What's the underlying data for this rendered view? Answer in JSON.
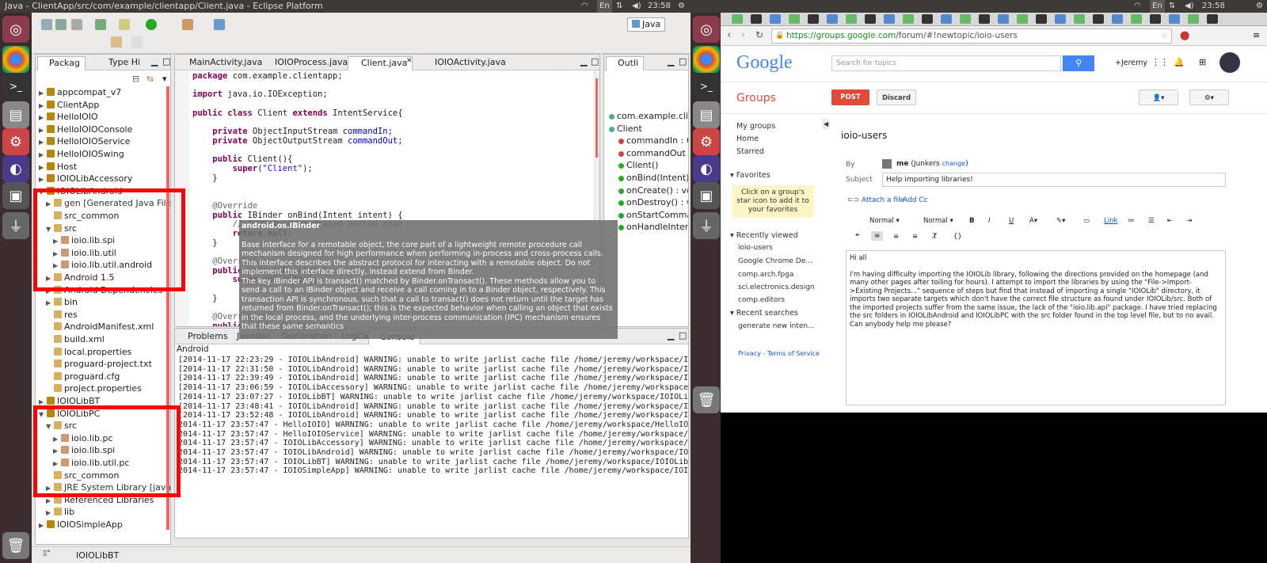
{
  "system": {
    "window_title_left": "Java - ClientApp/src/com/example/clientapp/Client.java - Eclipse Platform",
    "keyboard": "En",
    "time_left": "23:58",
    "time_right": "23:58"
  },
  "eclipse": {
    "perspective": "Java",
    "left_tabs": [
      "Packag",
      "Type Hi"
    ],
    "editor_tabs": [
      "MainActivity.java",
      "IOIOProcess.java",
      "Client.java",
      "IOIOActivity.java"
    ],
    "outline_tab": "Outli",
    "tree": [
      {
        "t": "appcompat_v7",
        "d": 0,
        "tw": "▶"
      },
      {
        "t": "ClientApp",
        "d": 0,
        "tw": "▶"
      },
      {
        "t": "HelloIOIO",
        "d": 0,
        "tw": "▶"
      },
      {
        "t": "HelloIOIOConsole",
        "d": 0,
        "tw": "▶"
      },
      {
        "t": "HelloIOIOService",
        "d": 0,
        "tw": "▶"
      },
      {
        "t": "HelloIOIOSwing",
        "d": 0,
        "tw": "▶"
      },
      {
        "t": "Host",
        "d": 0,
        "tw": "▶"
      },
      {
        "t": "IOIOLibAccessory",
        "d": 0,
        "tw": "▶"
      },
      {
        "t": "IOIOLibAndroid",
        "d": 0,
        "tw": "▼"
      },
      {
        "t": "gen [Generated Java Files]",
        "d": 1,
        "tw": "▶"
      },
      {
        "t": "src_common",
        "d": 1,
        "tw": ""
      },
      {
        "t": "src",
        "d": 1,
        "tw": "▼"
      },
      {
        "t": "ioio.lib.spi",
        "d": 2,
        "tw": "▶"
      },
      {
        "t": "ioio.lib.util",
        "d": 2,
        "tw": "▶"
      },
      {
        "t": "ioio.lib.util.android",
        "d": 2,
        "tw": "▶"
      },
      {
        "t": "Android 1.5",
        "d": 1,
        "tw": "▶"
      },
      {
        "t": "Android Dependencies",
        "d": 1,
        "tw": "▶"
      },
      {
        "t": "bin",
        "d": 1,
        "tw": "▶"
      },
      {
        "t": "res",
        "d": 1,
        "tw": ""
      },
      {
        "t": "AndroidManifest.xml",
        "d": 1,
        "tw": ""
      },
      {
        "t": "build.xml",
        "d": 1,
        "tw": ""
      },
      {
        "t": "local.properties",
        "d": 1,
        "tw": ""
      },
      {
        "t": "proguard-project.txt",
        "d": 1,
        "tw": ""
      },
      {
        "t": "proguard.cfg",
        "d": 1,
        "tw": ""
      },
      {
        "t": "project.properties",
        "d": 1,
        "tw": ""
      },
      {
        "t": "IOIOLibBT",
        "d": 0,
        "tw": "▶"
      },
      {
        "t": "IOIOLibPC",
        "d": 0,
        "tw": "▼"
      },
      {
        "t": "src",
        "d": 1,
        "tw": "▼"
      },
      {
        "t": "ioio.lib.pc",
        "d": 2,
        "tw": "▶"
      },
      {
        "t": "ioio.lib.spi",
        "d": 2,
        "tw": "▶"
      },
      {
        "t": "ioio.lib.util.pc",
        "d": 2,
        "tw": "▶"
      },
      {
        "t": "src_common",
        "d": 1,
        "tw": ""
      },
      {
        "t": "JRE System Library [java-6-orac",
        "d": 1,
        "tw": "▶"
      },
      {
        "t": "Referenced Libraries",
        "d": 1,
        "tw": "▶"
      },
      {
        "t": "lib",
        "d": 1,
        "tw": "▶"
      },
      {
        "t": "IOIOSimpleApp",
        "d": 0,
        "tw": "▶"
      }
    ],
    "outline": [
      "com.example.cli",
      "Client",
      "commandIn : O",
      "commandOut :",
      "Client()",
      "onBind(Intent)",
      "onCreate() : vo",
      "onDestroy() : v",
      "onStartComma",
      "onHandleIntent"
    ],
    "code": [
      "package com.example.clientapp;",
      "",
      "import java.io.IOException;",
      "",
      "public class Client extends IntentService{",
      "",
      "    private ObjectInputStream commandIn;",
      "    private ObjectOutputStream commandOut;",
      "",
      "    public Client(){",
      "        super(\"Client\");",
      "    }",
      "",
      "",
      "    @Override",
      "    public IBinder onBind(Intent intent) {",
      "        // TODO Auto-generated method stub",
      "        return null;",
      "    }",
      "",
      "    @Override",
      "    public void onCreate(){",
      "        super.onCreate();",
      "",
      "    }",
      "",
      "    @Override",
      "    public void onDestroy(){"
    ],
    "tooltip": {
      "title": "android.os.IBinder",
      "p1": "Base interface for a remotable object, the core part of a lightweight remote procedure call mechanism designed for high performance when performing in-process and cross-process calls. This interface describes the abstract protocol for interacting with a remotable object. Do not implement this interface directly, instead extend from Binder.",
      "p2": "The key IBinder API is transact() matched by Binder.onTransact(). These methods allow you to send a call to an IBinder object and receive a call coming in to a Binder object, respectively. This transaction API is synchronous, such that a call to transact() does not return until the target has returned from Binder.onTransact(); this is the expected behavior when calling an object that exists in the local process, and the underlying inter-process communication (IPC) mechanism ensures that these same semantics"
    },
    "bottom_tabs": [
      "Problems",
      "Javadoc",
      "Declaration",
      "LogCat",
      "Console"
    ],
    "console_label": "Android",
    "console": [
      "[2014-11-17 22:23:29 - IOIOLibAndroid] WARNING: unable to write jarlist cache file /home/jeremy/workspace/IOIOLibAndro",
      "[2014-11-17 22:31:50 - IOIOLibAndroid] WARNING: unable to write jarlist cache file /home/jeremy/workspace/IOIOLibAndro",
      "[2014-11-17 22:39:49 - IOIOLibAndroid] WARNING: unable to write jarlist cache file /home/jeremy/workspace/IOIOLibAndro",
      "[2014-11-17 23:06:59 - IOIOLibAccessory] WARNING: unable to write jarlist cache file /home/jeremy/workspace/IOIOLibAcce",
      "[2014-11-17 23:07:27 - IOIOLibBT] WARNING: unable to write jarlist cache file /home/jeremy/workspace/IOIOLibBT/bin/jar",
      "[2014-11-17 23:48:41 - IOIOLibAndroid] WARNING: unable to write jarlist cache file /home/jeremy/workspace/IOIOLibAndro",
      "[2014-11-17 23:52:48 - IOIOLibAndroid] WARNING: unable to write jarlist cache file /home/jeremy/workspace/IOIOLibAndro",
      "2014-11-17 23:57:47 - HelloIOIO] WARNING: unable to write jarlist cache file /home/jeremy/workspace/HelloIOIO/bin/jar",
      "2014-11-17 23:57:47 - HelloIOIOService] WARNING: unable to write jarlist cache file /home/jeremy/workspace/HelloIOIOSe",
      "2014-11-17 23:57:47 - IOIOLibAccessory] WARNING: unable to write jarlist cache file /home/jeremy/workspace/IOIOLibAcce",
      "2014-11-17 23:57:47 - IOIOLibAndroid] WARNING: unable to write jarlist cache file /home/jeremy/workspace/IOIOLibAndro",
      "2014-11-17 23:57:47 - IOIOLibBT] WARNING: unable to write jarlist cache file /home/jeremy/workspace/IOIOLibBT/bin/jar",
      "2014-11-17 23:57:47 - IOIOSimpleApp] WARNING: unable to write jarlist cache file /home/jeremy/workspace/IOIOSimpleApp/"
    ],
    "status": "IOIOLibBT"
  },
  "chrome": {
    "url": "https://groups.google.com/forum/#!newtopic/ioio-users",
    "url_host": "https://groups.google.com",
    "url_path": "/forum/#!newtopic/ioio-users",
    "google_logo": "Google",
    "search_placeholder": "Search for topics",
    "user": "+Jeremy",
    "groups_title": "Groups",
    "post": "POST",
    "discard": "Discard",
    "nav": {
      "my_groups": "My groups",
      "home": "Home",
      "starred": "Starred",
      "favorites": "Favorites",
      "fav_hint": "Click on a group's star icon to add it to your favorites",
      "recently_viewed": "Recently viewed",
      "recent": [
        "ioio-users",
        "Google Chrome De...",
        "comp.arch.fpga",
        "sci.electronics.design",
        "comp.editors"
      ],
      "recent_searches": "Recent searches",
      "searches": [
        "generate new inten..."
      ],
      "privacy": "Privacy",
      "terms": "Terms of Service"
    },
    "group_name": "ioio-users",
    "by_label": "By",
    "me": "me",
    "junkers": "(Junkers",
    "change": "change",
    "paren": ")",
    "subject_label": "Subject",
    "subject": "Help importing libraries!",
    "attach": "Attach a file",
    "add_cc": "Add Cc",
    "font1": "Normal",
    "font2": "Normal",
    "link": "Link",
    "body1": "Hi all",
    "body2": "I'm having difficulty importing the IOIOLib library, following the directions provided on the homepage (and many other pages after toiling for hours). I attempt to import the libraries by using the \"File->Import->Existing Projects...\" sequence of steps but find that instead of importing a single \"IOIOLib\" directory, it imports two separate targets which don't have the correct file structure as found under IOIOLib/src. Both of the imported projects suffer from the same issue, the lack of the \"ioio.lib.api\" package. I have tried replacing the src folders in IOIOLibAndroid and IOIOLibPC with the src folder found in the top level file, but to no avail. Can anybody help me please?"
  }
}
